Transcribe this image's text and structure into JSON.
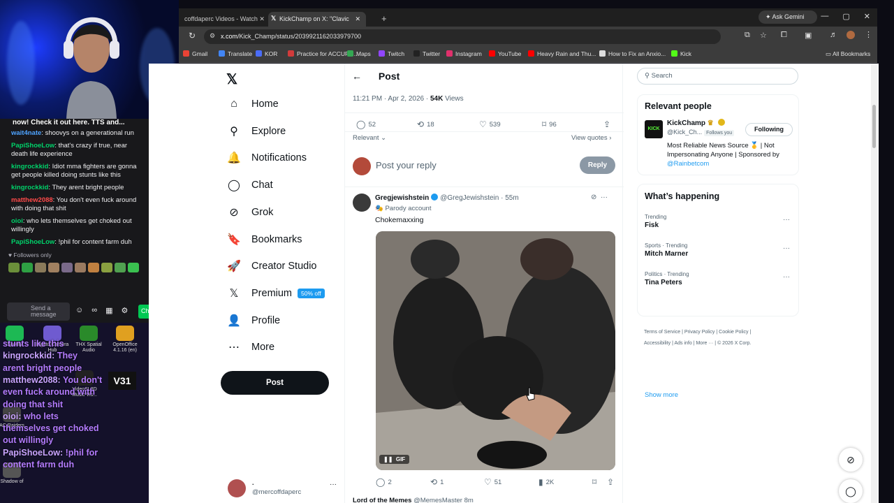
{
  "stream": {
    "chat_top": "now! Check it out here. TTS and...",
    "messages": [
      {
        "user": "wait4nate",
        "user_color": "#4ea3ff",
        "text": "shoovys on a generational run"
      },
      {
        "user": "PapiShoeLow",
        "user_color": "#00d26a",
        "text": "that's crazy if true, near death life experience"
      },
      {
        "user": "kingrockkid",
        "user_color": "#00d26a",
        "text": "Idiot mma fighters are gonna get people killed doing stunts like this"
      },
      {
        "user": "kingrockkid",
        "user_color": "#00d26a",
        "text": "They arent bright people"
      },
      {
        "user": "matthew2088",
        "user_color": "#ff4a4a",
        "text": "You don't even fuck around with doing that shit"
      },
      {
        "user": "oioi",
        "user_color": "#00d26a",
        "text": "who lets themselves get choked out willingly"
      },
      {
        "user": "PapiShoeLow",
        "user_color": "#00d26a",
        "text": "!phil for content farm duh"
      }
    ],
    "followers_only": "Followers only",
    "send_placeholder": "Send a message",
    "chat_button": "Ch",
    "desktop_icons": [
      {
        "label": "Spotify",
        "color": "#1db954"
      },
      {
        "label": "Elgato Camera Hub",
        "color": "#6f5bd0"
      },
      {
        "label": "THX Spatial Audio",
        "color": "#2a8a2a"
      },
      {
        "label": "OpenOffice 4.1.16 (en)",
        "color": "#e0a020"
      },
      {
        "label": "VideoSL3D Music Vis...",
        "color": "#222"
      },
      {
        "label": "AC Raiders",
        "color": "#444"
      },
      {
        "label": "Shadow of",
        "color": "#555"
      }
    ],
    "overlay_lines": [
      {
        "user": "",
        "text": "stunts like this"
      },
      {
        "user": "kingrockkid:",
        "text": "They"
      },
      {
        "user": "",
        "text": "arent bright people"
      },
      {
        "user": "matthew2088:",
        "text": "You don't"
      },
      {
        "user": "",
        "text": "even fuck around with"
      },
      {
        "user": "",
        "text": "doing that shit"
      },
      {
        "user": "oioi:",
        "text": "who lets"
      },
      {
        "user": "",
        "text": "themselves get choked"
      },
      {
        "user": "",
        "text": "out willingly"
      },
      {
        "user": "PapiShoeLow:",
        "text": "!phil for"
      },
      {
        "user": "",
        "text": "content farm duh"
      }
    ],
    "v31_label": "V31"
  },
  "browser": {
    "tab1": "coffdaperc Videos - Watch",
    "tab2": "KickChamp on X: \"Clavic",
    "new_tab": "+",
    "url_host": "x.com",
    "url_path": "/Kick_Champ/status/2039921162033979700",
    "gemini": "Ask Gemini",
    "bookmarks": [
      {
        "label": "Gmail",
        "color": "#ea4335"
      },
      {
        "label": "Translate",
        "color": "#4285f4"
      },
      {
        "label": "KOR",
        "color": "#4a6cf7"
      },
      {
        "label": "Practice for ACCUPL...",
        "color": "#d23b3b"
      },
      {
        "label": "Maps",
        "color": "#34a853"
      },
      {
        "label": "Twitch",
        "color": "#9146ff"
      },
      {
        "label": "Twitter",
        "color": "#222222"
      },
      {
        "label": "Instagram",
        "color": "#e1306c"
      },
      {
        "label": "YouTube",
        "color": "#ff0000"
      },
      {
        "label": "Heavy Rain and Thu...",
        "color": "#ff0000"
      },
      {
        "label": "How to Fix an Anxio...",
        "color": "#dddddd"
      },
      {
        "label": "Kick",
        "color": "#53fc18"
      }
    ],
    "all_bookmarks": "All Bookmarks"
  },
  "nav": {
    "items": [
      {
        "label": "Home",
        "icon": "home-icon",
        "glyph": "⌂"
      },
      {
        "label": "Explore",
        "icon": "search-icon",
        "glyph": "⚲"
      },
      {
        "label": "Notifications",
        "icon": "bell-icon",
        "glyph": "🔔"
      },
      {
        "label": "Chat",
        "icon": "chat-icon",
        "glyph": "◯"
      },
      {
        "label": "Grok",
        "icon": "grok-icon",
        "glyph": "⊘"
      },
      {
        "label": "Bookmarks",
        "icon": "bookmark-icon",
        "glyph": "🔖"
      },
      {
        "label": "Creator Studio",
        "icon": "rocket-icon",
        "glyph": "🚀"
      },
      {
        "label": "Premium",
        "icon": "x-icon",
        "glyph": "𝕏"
      },
      {
        "label": "Profile",
        "icon": "person-icon",
        "glyph": "👤"
      },
      {
        "label": "More",
        "icon": "more-icon",
        "glyph": "⋯"
      }
    ],
    "premium_badge": "50% off",
    "post_button": "Post",
    "account_name": ".",
    "account_handle": "@mercoffdaperc"
  },
  "post": {
    "header": "Post",
    "time": "11:21 PM · Apr 2, 2026 ·",
    "views_count": "54K",
    "views_label": "Views",
    "stats": {
      "replies": "52",
      "reposts": "18",
      "likes": "539",
      "bookmarks": "96"
    },
    "sort": "Relevant",
    "view_quotes": "View quotes",
    "reply_placeholder": "Post your reply",
    "reply_button": "Reply"
  },
  "reply_tweet": {
    "name": "Gregjewishstein",
    "handle": "@GregJewishstein",
    "time": "55m",
    "parody": "Parody account",
    "text": "Chokemaxxing",
    "gif_label": "GIF",
    "stats": {
      "replies": "2",
      "reposts": "1",
      "likes": "51",
      "views": "2K"
    }
  },
  "next_tweet": {
    "name": "Lord of the Memes",
    "handle": "@MemesMaster",
    "time": "8m"
  },
  "sidebar": {
    "search_placeholder": "Search",
    "relevant_title": "Relevant people",
    "person_name": "KickChamp",
    "person_handle": "@Kick_Ch...",
    "follows_you": "Follows you",
    "following_button": "Following",
    "bio": "Most Reliable News Source 🥇 | Not Impersonating Anyone | Sponsored by",
    "bio_link": "@Rainbetcom",
    "happening_title": "What’s happening",
    "trends": [
      {
        "context": "Trending",
        "name": "Fisk"
      },
      {
        "context": "Sports · Trending",
        "name": "Mitch Marner"
      },
      {
        "context": "Politics · Trending",
        "name": "Tina Peters"
      }
    ],
    "show_more": "Show more",
    "footer": [
      "Terms of Service",
      "Privacy Policy",
      "Cookie Policy",
      "Accessibility",
      "Ads info",
      "More ···",
      "© 2026 X Corp."
    ]
  }
}
